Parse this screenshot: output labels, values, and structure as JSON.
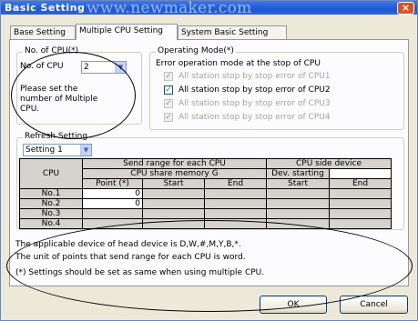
{
  "window": {
    "title": "Basic Setting",
    "watermark": "www.newmaker.com",
    "close_glyph": "×"
  },
  "tabs": [
    {
      "label": "Base Setting",
      "active": false
    },
    {
      "label": "Multiple CPU Setting",
      "active": true
    },
    {
      "label": "System Basic Setting",
      "active": false
    }
  ],
  "cpu_count": {
    "group_title": "No. of CPU(*)",
    "field_label": "No. of CPU",
    "value": "2",
    "note": [
      "Please set the",
      "number of Multiple",
      "CPU."
    ]
  },
  "operating_mode": {
    "group_title": "Operating Mode(*)",
    "description": "Error operation mode at the stop of CPU",
    "options": [
      {
        "label": "All station stop by stop error of CPU1",
        "checked": true,
        "enabled": false
      },
      {
        "label": "All station stop by stop error of CPU2",
        "checked": true,
        "enabled": true
      },
      {
        "label": "All station stop by stop error of CPU3",
        "checked": true,
        "enabled": false
      },
      {
        "label": "All station stop by stop error of CPU4",
        "checked": true,
        "enabled": false
      }
    ],
    "check_glyph": "✓"
  },
  "refresh": {
    "group_title": "Refresh Setting",
    "selected": "Setting 1",
    "table": {
      "col_cpu": "CPU",
      "send_range": "Send range for each CPU",
      "share_memory": "CPU share memory G",
      "point": "Point (*)",
      "start": "Start",
      "end": "End",
      "side_device": "CPU side device",
      "dev_starting": "Dev. starting",
      "rows": [
        {
          "cpu": "No.1",
          "point": "0"
        },
        {
          "cpu": "No.2",
          "point": "0"
        },
        {
          "cpu": "No.3",
          "point": ""
        },
        {
          "cpu": "No.4",
          "point": ""
        }
      ]
    }
  },
  "notes": {
    "line1": "The applicable device of head device is D,W,#,M,Y,B,*.",
    "line2": "The unit of points that send range for each CPU is word.",
    "line3": "(*) Settings should be set as same when using multiple CPU."
  },
  "buttons": {
    "ok": "OK",
    "cancel": "Cancel"
  },
  "dropdown_arrow": "▼"
}
